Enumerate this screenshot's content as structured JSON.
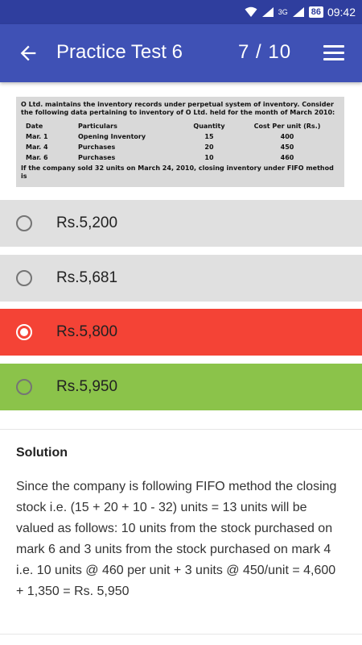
{
  "status_bar": {
    "battery": "86",
    "time": "09:42",
    "network": "3G"
  },
  "app_bar": {
    "title": "Practice Test 6",
    "counter": "7 / 10"
  },
  "question": {
    "intro": "O Ltd. maintains the inventory records under perpetual system of inventory. Consider the following data pertaining to inventory of O Ltd. held for the month of March 2010:",
    "headers": [
      "Date",
      "Particulars",
      "Quantity",
      "Cost Per unit (Rs.)"
    ],
    "rows": [
      [
        "Mar. 1",
        "Opening Inventory",
        "15",
        "400"
      ],
      [
        "Mar. 4",
        "Purchases",
        "20",
        "450"
      ],
      [
        "Mar. 6",
        "Purchases",
        "10",
        "460"
      ]
    ],
    "closing": "If the company sold 32 units on March 24, 2010, closing inventory under FIFO method is"
  },
  "options": [
    {
      "label": "Rs.5,200",
      "state": "unselected",
      "color": "#e0e0e0"
    },
    {
      "label": "Rs.5,681",
      "state": "unselected",
      "color": "#e0e0e0"
    },
    {
      "label": "Rs.5,800",
      "state": "selected-wrong",
      "color": "#f44336"
    },
    {
      "label": "Rs.5,950",
      "state": "correct",
      "color": "#8bc34a"
    }
  ],
  "solution": {
    "title": "Solution",
    "text": "Since the company is following FIFO method the closing stock i.e. (15 + 20 + 10 - 32) units = 13 units will be valued as follows: 10 units from the stock purchased on mark 6 and 3 units from the stock purchased on mark 4 i.e. 10 units @ 460 per unit + 3 units @ 450/unit = 4,600 + 1,350 = Rs. 5,950"
  },
  "colors": {
    "primary": "#3f51b5",
    "status": "#2f3e9e"
  }
}
